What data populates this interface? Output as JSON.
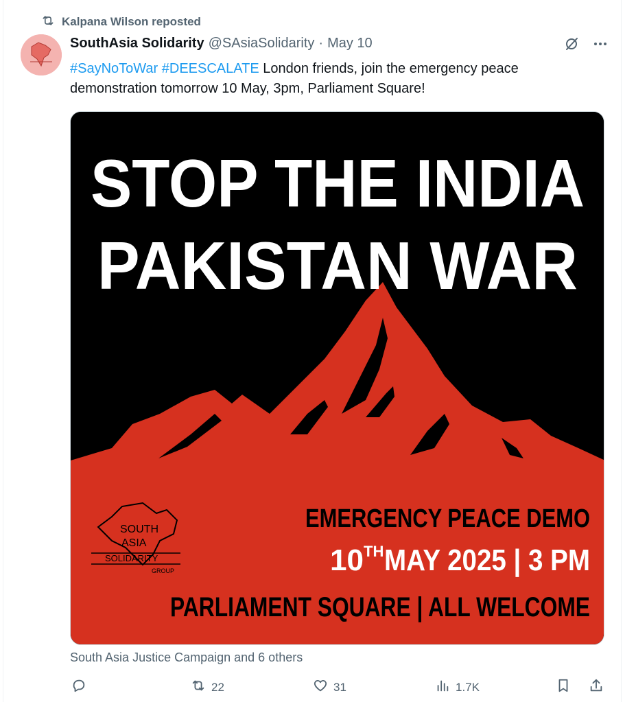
{
  "repost": {
    "text": "Kalpana Wilson reposted",
    "icon": "repost-icon"
  },
  "author": {
    "name": "SouthAsia Solidarity",
    "handle": "@SAsiaSolidarity",
    "separator": "·",
    "date": "May 10"
  },
  "tweet": {
    "hashtags": [
      "#SayNoToWar",
      "#DEESCALATE"
    ],
    "text": " London friends, join the emergency peace demonstration tomorrow 10 May, 3pm, Parliament Square!"
  },
  "poster": {
    "title_line1": "STOP THE INDIA",
    "title_line2": "PAKISTAN WAR",
    "event_name": "EMERGENCY PEACE DEMO",
    "date_day": "10",
    "date_suffix": "TH",
    "date_rest": "MAY 2025 | 3 PM",
    "venue": "PARLIAMENT SQUARE | ALL WELCOME",
    "logo_text": [
      "SOUTH",
      "ASIA",
      "SOLIDARITY",
      "GROUP"
    ],
    "colors": {
      "background": "#000000",
      "mountain": "#d6311f",
      "title": "#ffffff"
    }
  },
  "social_context": "South Asia Justice Campaign and 6 others",
  "actions": {
    "reply": {
      "icon": "reply-icon",
      "count": ""
    },
    "repost": {
      "icon": "repost-icon",
      "count": "22"
    },
    "like": {
      "icon": "heart-icon",
      "count": "31"
    },
    "views": {
      "icon": "views-icon",
      "count": "1.7K"
    },
    "bookmark": {
      "icon": "bookmark-icon"
    },
    "share": {
      "icon": "share-icon"
    }
  },
  "colors": {
    "link": "#1d9bf0",
    "muted": "#536471",
    "text": "#0f1419"
  }
}
